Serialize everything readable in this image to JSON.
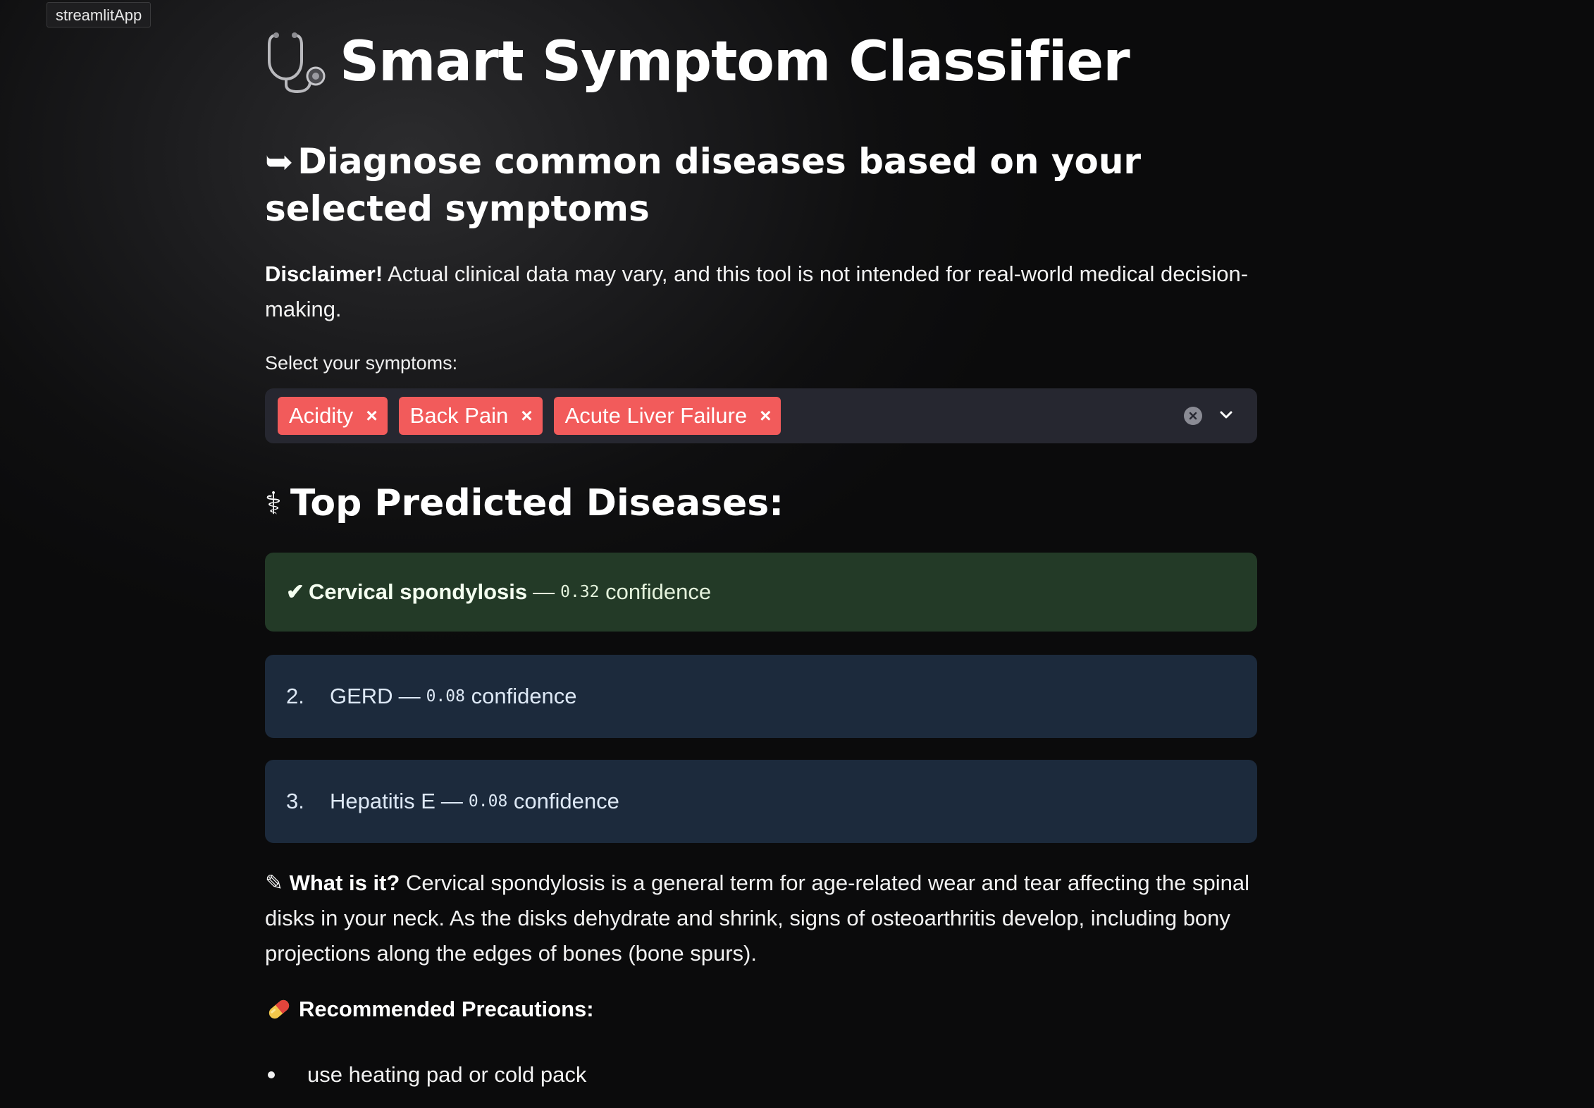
{
  "app": {
    "badge": "streamlitApp"
  },
  "header": {
    "title": "Smart Symptom Classifier",
    "title_icon": "stethoscope-icon",
    "subtitle_arrow": "➥",
    "subtitle": "Diagnose common diseases based on your selected symptoms"
  },
  "disclaimer": {
    "label": "Disclaimer!",
    "text": " Actual clinical data may vary, and this tool is not intended for real-world medical decision-making."
  },
  "symptom_select": {
    "label": "Select your symptoms:",
    "selected": [
      "Acidity",
      "Back Pain",
      "Acute Liver Failure"
    ],
    "remove_glyph": "×",
    "clear_icon": "clear-all-icon",
    "toggle_icon": "chevron-down-icon"
  },
  "predictions": {
    "heading_icon": "⚕",
    "heading": "Top Predicted Diseases:",
    "top": {
      "mark": "✔",
      "name": "Cervical spondylosis",
      "dash": "—",
      "confidence": "0.32",
      "suffix": "confidence"
    },
    "others": [
      {
        "rank": "2.",
        "name": "GERD",
        "dash": "—",
        "confidence": "0.08",
        "suffix": "confidence"
      },
      {
        "rank": "3.",
        "name": "Hepatitis E",
        "dash": "—",
        "confidence": "0.08",
        "suffix": "confidence"
      }
    ]
  },
  "description": {
    "icon": "✎",
    "label": "What is it?",
    "text": " Cervical spondylosis is a general term for age-related wear and tear affecting the spinal disks in your neck. As the disks dehydrate and shrink, signs of osteoarthritis develop, including bony projections along the edges of bones (bone spurs)."
  },
  "precautions": {
    "icon": "pill-icon",
    "title": "Recommended Precautions:",
    "items": [
      "use heating pad or cold pack"
    ]
  },
  "colors": {
    "chip": "#f25b5b",
    "top_result_bg": "#233a27",
    "other_result_bg": "#1c2a3c",
    "select_bg": "#262730"
  }
}
